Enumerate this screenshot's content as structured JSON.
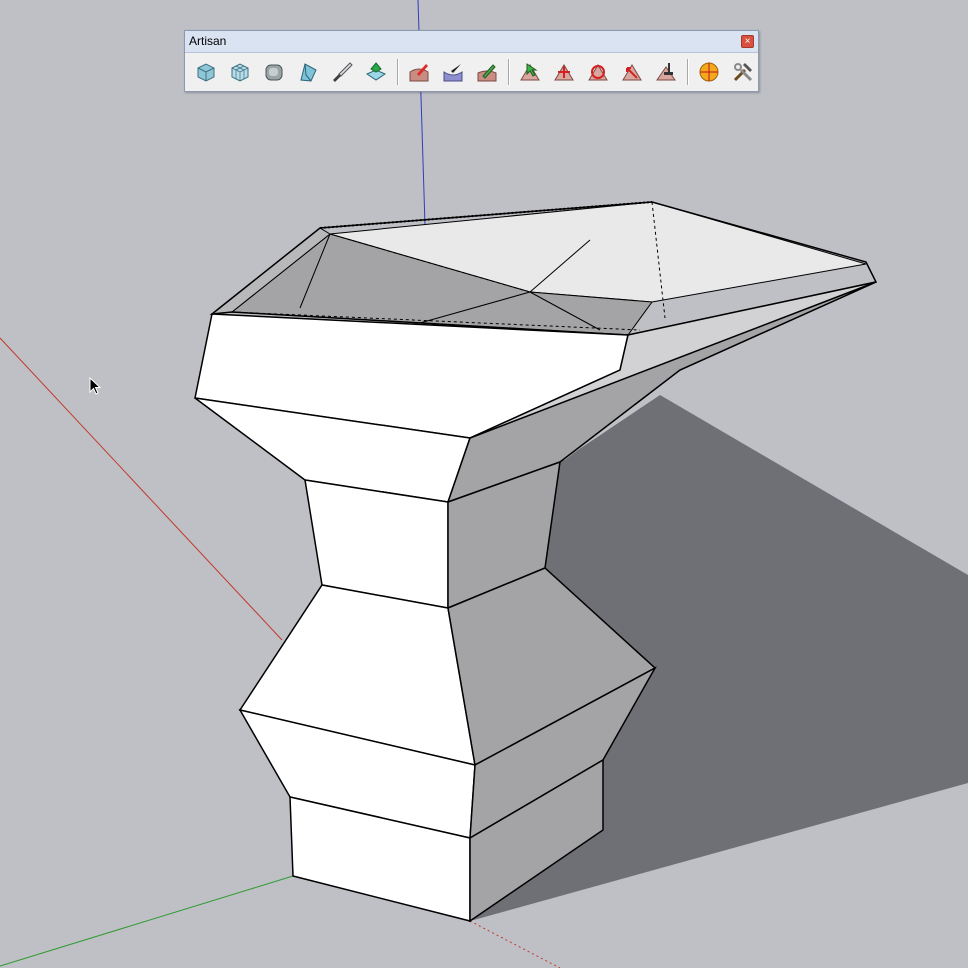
{
  "toolbar": {
    "title": "Artisan",
    "close_label": "×",
    "buttons": [
      {
        "name": "subdivide-smooth-button",
        "icon": "cube-smooth-icon"
      },
      {
        "name": "subdivide-button",
        "icon": "cube-subdivide-icon"
      },
      {
        "name": "smooth-button",
        "icon": "cube-rounded-icon"
      },
      {
        "name": "knife-subdivide-button",
        "icon": "face-wedge-icon"
      },
      {
        "name": "knife-cut-button",
        "icon": "knife-icon"
      },
      {
        "name": "crease-tool-button",
        "icon": "crease-icon"
      },
      {
        "name": "sculpt-add-button",
        "icon": "brush-add-icon"
      },
      {
        "name": "sculpt-subtract-button",
        "icon": "brush-subtract-icon"
      },
      {
        "name": "sculpt-smooth-button",
        "icon": "brush-smooth-icon"
      },
      {
        "name": "select-vertices-button",
        "icon": "select-vertex-icon"
      },
      {
        "name": "move-vertices-button",
        "icon": "move-vertex-icon"
      },
      {
        "name": "rotate-vertices-button",
        "icon": "rotate-vertex-icon"
      },
      {
        "name": "scale-vertices-button",
        "icon": "scale-vertex-icon"
      },
      {
        "name": "paint-select-button",
        "icon": "paint-select-icon"
      },
      {
        "name": "organic-shapes-button",
        "icon": "orange-ball-icon"
      },
      {
        "name": "tools-button",
        "icon": "hammer-wrench-icon"
      }
    ]
  },
  "scene": {
    "background": "#bfc0c6",
    "axis_red": "#c0392b",
    "axis_green": "#2e9a2e",
    "axis_blue": "#2f3fb8",
    "shadow": "#6f6f76",
    "face_light": "#ffffff",
    "face_dark": "#a2a2a4"
  }
}
